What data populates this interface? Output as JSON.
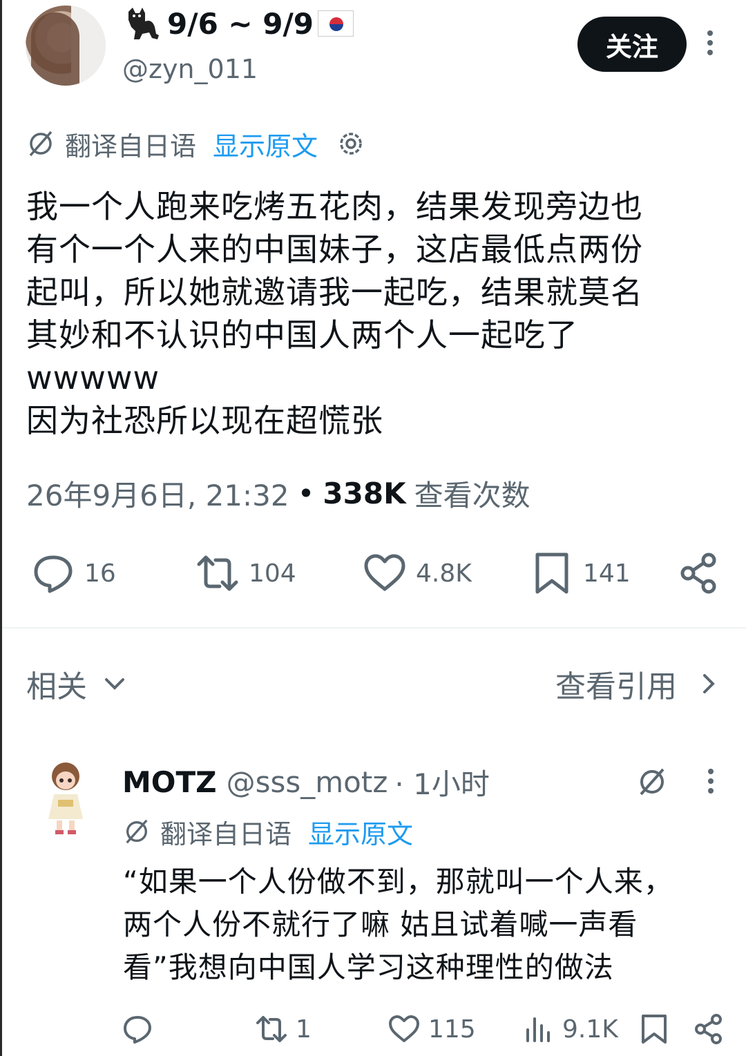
{
  "post": {
    "author_name": "9/6 ~ 9/9",
    "author_handle": "@zyn_011",
    "follow_label": "关注",
    "translation": {
      "label": "翻译自日语",
      "show_original": "显示原文"
    },
    "text": "我一个人跑来吃烤五花肉，结果发现旁边也\n有个一个人来的中国妹子，这店最低点两份\n起叫，所以她就邀请我一起吃，结果就莫名\n其妙和不认识的中国人两个人一起吃了\nwwwww\n因为社恐所以现在超慌张",
    "date": "26年9月6日, 21:32",
    "separator": "•",
    "views_count": "338K",
    "views_label": "查看次数",
    "stats": {
      "replies": "16",
      "reposts": "104",
      "likes": "4.8K",
      "bookmarks": "141"
    }
  },
  "related": {
    "label": "相关",
    "quotes_label": "查看引用"
  },
  "reply": {
    "name": "MOTZ",
    "handle": "@sss_motz",
    "time": "· 1小时",
    "translation": {
      "label": "翻译自日语",
      "show_original": "显示原文"
    },
    "text": "“如果一个人份做不到，那就叫一个人来，\n两个人份不就行了嘛   姑且试着喊一声看\n看”我想向中国人学习这种理性的做法",
    "stats": {
      "reposts": "1",
      "likes": "115",
      "views": "9.1K"
    }
  },
  "icons": [
    "cat-icon",
    "korea-flag-icon",
    "more-icon",
    "globe-icon",
    "gear-icon",
    "reply-icon",
    "repost-icon",
    "like-icon",
    "bookmark-icon",
    "share-icon",
    "chevron-down-icon",
    "chevron-right-icon",
    "views-icon"
  ],
  "colors": {
    "accent": "#1d9bf0",
    "text": "#0f1419",
    "muted": "#5b6770"
  }
}
